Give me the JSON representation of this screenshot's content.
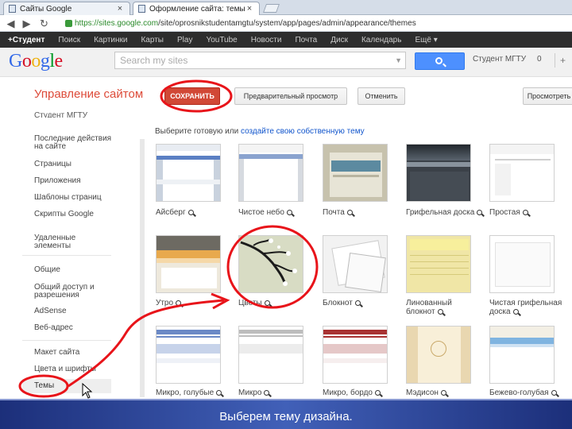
{
  "browser": {
    "tabs": [
      {
        "label": "Сайты Google",
        "active": false
      },
      {
        "label": "Оформление сайта: темы",
        "active": true
      }
    ],
    "url_host": "https://sites.google.com",
    "url_path": "/site/oprosnikstudentamgtu/system/app/pages/admin/appearance/themes"
  },
  "gbar": [
    "+Студент",
    "Поиск",
    "Картинки",
    "Карты",
    "Play",
    "YouTube",
    "Новости",
    "Почта",
    "Диск",
    "Календарь",
    "Ещё ▾"
  ],
  "header": {
    "logo": "Google",
    "search_placeholder": "Search my sites",
    "user": "Студент МГТУ",
    "count": "0"
  },
  "toolbar": {
    "title": "Управление сайтом",
    "save": "СОХРАНИТЬ",
    "preview": "Предварительный просмотр",
    "cancel": "Отменить",
    "view": "Просмотреть"
  },
  "sidebar": {
    "site_name": "Студент МГТУ",
    "items": [
      "Последние действия на сайте",
      "Страницы",
      "Приложения",
      "Шаблоны страниц",
      "Скрипты Google",
      "Удаленные элементы",
      "Общие",
      "Общий доступ и разрешения",
      "AdSense",
      "Веб-адрес",
      "Макет сайта",
      "Цвета и шрифты",
      "Темы"
    ]
  },
  "content": {
    "instruction_prefix": "Выберите готовую или",
    "instruction_link": "создайте свою собственную тему",
    "themes": [
      "Айсберг",
      "Чистое небо",
      "Почта",
      "Грифельная доска",
      "Простая",
      "Утро",
      "Цветы",
      "Блокнот",
      "Линованный блокнот",
      "Чистая грифельная доска",
      "Микро, голубые",
      "Микро",
      "Микро, бордо",
      "Мэдисон",
      "Бежево-голубая"
    ]
  },
  "caption": "Выберем тему дизайна.",
  "colors": {
    "accent_red": "#dd4b39",
    "save_button": "#d14836",
    "search_button": "#4d90fe",
    "annotation": "#e8141a",
    "caption_band": "#2b44a0"
  }
}
